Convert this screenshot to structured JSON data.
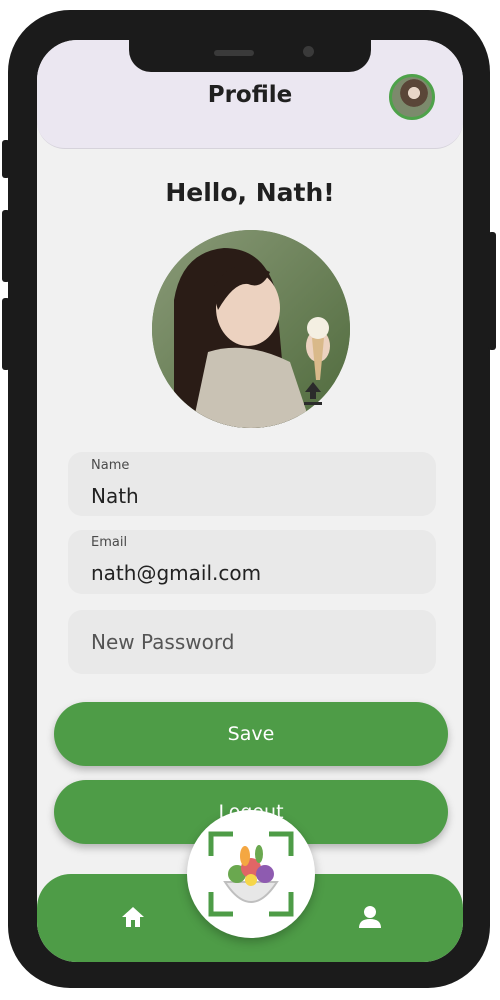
{
  "header": {
    "title": "Profile",
    "avatar_icon": "user-avatar"
  },
  "greeting": "Hello, Nath!",
  "profile_photo": {
    "icon": "profile-photo",
    "upload_icon": "upload-icon"
  },
  "fields": [
    {
      "label": "Name",
      "value": "Nath"
    },
    {
      "label": "Email",
      "value": "nath@gmail.com"
    },
    {
      "placeholder": "New Password",
      "value": ""
    }
  ],
  "buttons": {
    "save": "Save",
    "logout": "Logout"
  },
  "nav": {
    "home_icon": "home-icon",
    "scan_icon": "scan-food-icon",
    "profile_icon": "person-icon"
  },
  "colors": {
    "accent": "#4e9c47",
    "header_bg": "#ebe7f1",
    "screen_bg": "#f1f1f1",
    "field_bg": "#e9e9e9"
  }
}
